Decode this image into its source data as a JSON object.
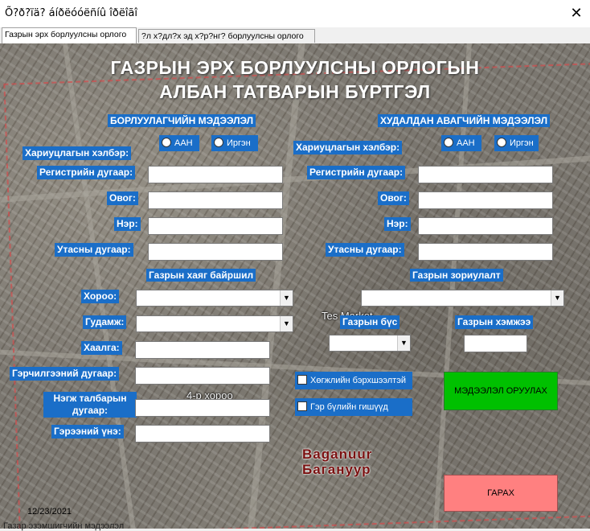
{
  "window": {
    "title": "Õ?ð?ïä? áíðëóóëñíû îðëîãî",
    "close_glyph": "✕"
  },
  "tabs": [
    {
      "label": "Газрын эрх борлуулсны орлого"
    },
    {
      "label": "?л х?дл?х эд х?р?нг? борлуулсны орлого"
    }
  ],
  "header": {
    "title_line1": "ГАЗРЫН ЭРХ БОРЛУУЛСНЫ ОРЛОГЫН",
    "title_line2": "АЛБАН ТАТВАРЫН БҮРТГЭЛ"
  },
  "seller": {
    "section": "БОРЛУУЛАГЧИЙН МЭДЭЭЛЭЛ",
    "ownership_label": "Хариуцлагын хэлбэр:",
    "option_org": "ААН",
    "option_citizen": "Иргэн",
    "register_label": "Регистрийн дугаар:",
    "surname_label": "Овог:",
    "name_label": "Нэр:",
    "phone_label": "Утасны дугаар:"
  },
  "buyer": {
    "section": "ХУДАЛДАН АВАГЧИЙН МЭДЭЭЛЭЛ",
    "ownership_label": "Хариуцлагын хэлбэр:",
    "option_org": "ААН",
    "option_citizen": "Иргэн",
    "register_label": "Регистрийн дугаар:",
    "surname_label": "Овог:",
    "name_label": "Нэр:",
    "phone_label": "Утасны дугаар:"
  },
  "address": {
    "section": "Газрын хаяг байршил",
    "khoroo_label": "Хороо:",
    "street_label": "Гудамж:",
    "gate_label": "Хаалга:",
    "certificate_label": "Гэрчилгээний дугаар:",
    "unit_area_label": "Нэгж талбарын дугаар:",
    "contract_price_label": "Гэрээний үнэ:"
  },
  "land": {
    "purpose_section": "Газрын  зориулалт",
    "type_label": "Газрын бүс",
    "size_label": "Газрын хэмжээ"
  },
  "checkboxes": {
    "disabled": "Хөгжлийн бэрхшээлтэй",
    "family_member": "Гэр бүлийн гишүүд"
  },
  "buttons": {
    "submit": "МЭДЭЭЛЭЛ ОРУУЛАХ",
    "exit": "ГАРАХ"
  },
  "map": {
    "label_shop": "Tes Market",
    "label_khoroo": "4-р хороо",
    "label_city": "Baganuur\nБагануур"
  },
  "footer": {
    "date": "12/23/2021",
    "bottom_text": "Газар эзэмшигчийн мэдээлэл"
  },
  "colors": {
    "label_bg": "#1a6ec8",
    "submit_bg": "#00c000",
    "exit_bg": "#ff8080"
  },
  "icons": {
    "dropdown": "chevron-down-icon",
    "close": "close-icon"
  }
}
